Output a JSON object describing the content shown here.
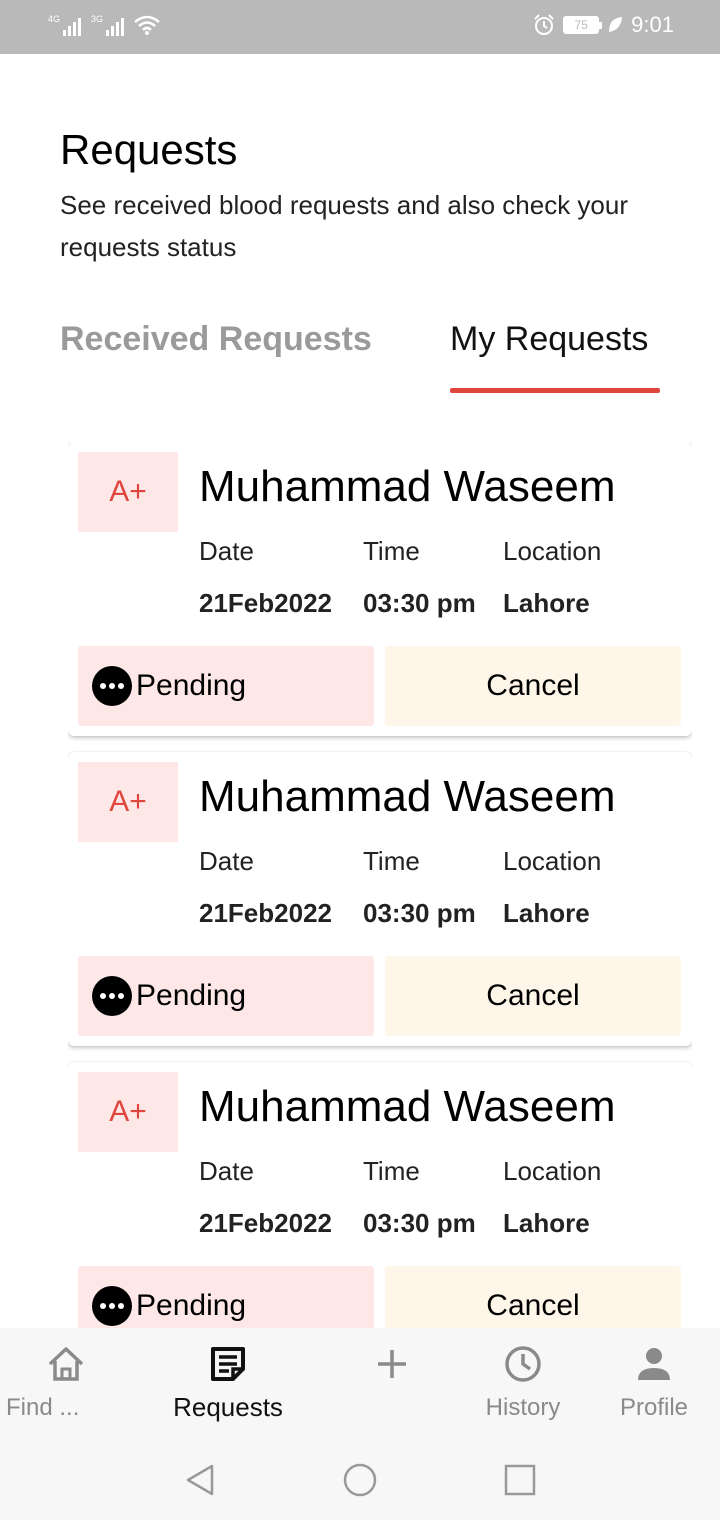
{
  "status_bar": {
    "network_1": "4G",
    "network_2": "3G",
    "battery": "75",
    "time": "9:01"
  },
  "header": {
    "title": "Requests",
    "subtitle": "See received blood requests and also check your requests status"
  },
  "tabs": [
    {
      "label": "Received Requests",
      "active": false
    },
    {
      "label": "My Requests",
      "active": true
    }
  ],
  "columns": {
    "date": "Date",
    "time": "Time",
    "location": "Location"
  },
  "requests": [
    {
      "blood_group": "A+",
      "name": "Muhammad Waseem",
      "date": "21Feb2022",
      "time": "03:30 pm",
      "location": "Lahore",
      "status": "Pending",
      "action": "Cancel"
    },
    {
      "blood_group": "A+",
      "name": "Muhammad Waseem",
      "date": "21Feb2022",
      "time": "03:30 pm",
      "location": "Lahore",
      "status": "Pending",
      "action": "Cancel"
    },
    {
      "blood_group": "A+",
      "name": "Muhammad Waseem",
      "date": "21Feb2022",
      "time": "03:30 pm",
      "location": "Lahore",
      "status": "Pending",
      "action": "Cancel"
    }
  ],
  "bottom_nav": [
    {
      "label": "Find ...",
      "icon": "home-icon",
      "active": false
    },
    {
      "label": "Requests",
      "icon": "requests-icon",
      "active": true
    },
    {
      "label": "",
      "icon": "add-icon",
      "active": false
    },
    {
      "label": "History",
      "icon": "history-icon",
      "active": false
    },
    {
      "label": "Profile",
      "icon": "profile-icon",
      "active": false
    }
  ],
  "colors": {
    "accent": "#e0463d",
    "badge_bg": "#fde8e7",
    "cancel_bg": "#fff6ea",
    "status_bar": "#b9b9b9"
  }
}
